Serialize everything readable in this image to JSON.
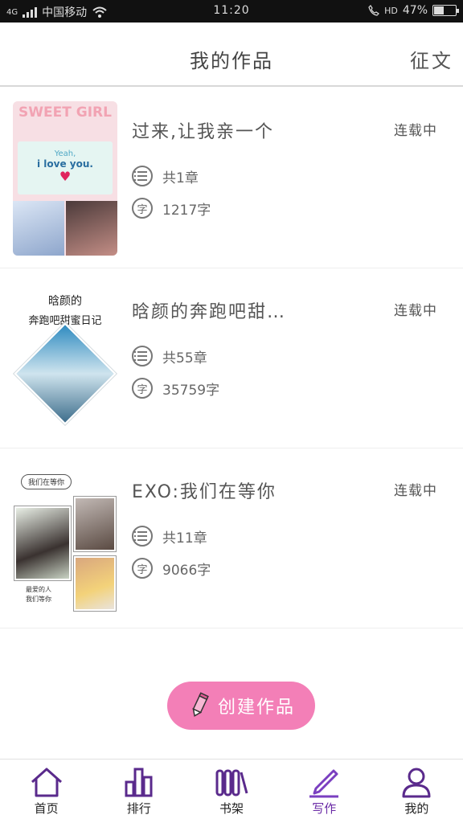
{
  "status_bar": {
    "network": "4G",
    "carrier": "中国移动",
    "time": "11:20",
    "hd": "HD",
    "battery": "47%",
    "battery_level": 0.47
  },
  "header": {
    "title": "我的作品",
    "contest_label": "征文"
  },
  "works": [
    {
      "title": "过来,让我亲一个",
      "status": "连载中",
      "chapters": "共1章",
      "words": "1217字",
      "cover": {
        "headline": "SWEET GIRL",
        "note_line1": "Yeah,",
        "note_line2": "i love you."
      }
    },
    {
      "title": "晗颜的奔跑吧甜…",
      "status": "连载中",
      "chapters": "共55章",
      "words": "35759字",
      "cover": {
        "line1": "晗颜的",
        "line2": "奔跑吧甜蜜日记"
      }
    },
    {
      "title": "EXO:我们在等你",
      "status": "连载中",
      "chapters": "共11章",
      "words": "9066字",
      "cover": {
        "tag": "我们在等你",
        "caption1": "最爱的人",
        "caption2": "我们等你"
      }
    }
  ],
  "icons": {
    "chapter": "list-icon",
    "word": "字"
  },
  "create_button": {
    "label": "创建作品"
  },
  "bottom_nav": [
    {
      "label": "首页",
      "icon": "home-icon"
    },
    {
      "label": "排行",
      "icon": "ranking-icon"
    },
    {
      "label": "书架",
      "icon": "bookshelf-icon"
    },
    {
      "label": "写作",
      "icon": "write-icon",
      "active": true
    },
    {
      "label": "我的",
      "icon": "profile-icon"
    }
  ],
  "colors": {
    "accent": "#6a2aa6",
    "button": "#f37fb7",
    "divider": "#d8d8d8"
  }
}
